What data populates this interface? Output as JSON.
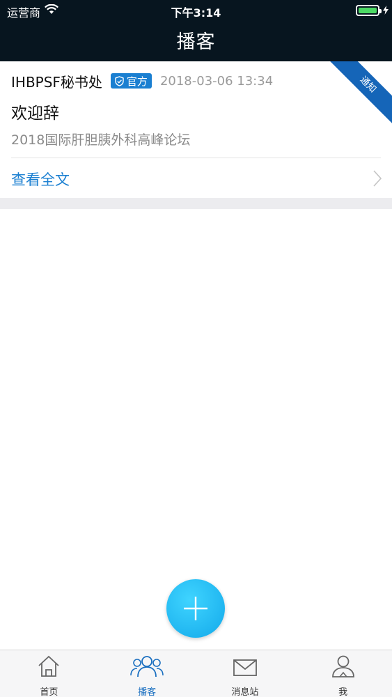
{
  "status_bar": {
    "carrier": "运营商",
    "time": "下午3:14",
    "battery_level": 1.0,
    "charging": true
  },
  "nav": {
    "title": "播客"
  },
  "post": {
    "author": "IHBPSF秘书处",
    "badge": "官方",
    "timestamp": "2018-03-06 13:34",
    "ribbon": "通知",
    "title": "欢迎辞",
    "summary": "2018国际肝胆胰外科高峰论坛",
    "read_more": "查看全文"
  },
  "fab": {
    "icon": "plus-icon"
  },
  "tabbar": {
    "active_index": 1,
    "items": [
      {
        "label": "首页",
        "icon": "home-icon"
      },
      {
        "label": "播客",
        "icon": "users-icon"
      },
      {
        "label": "消息站",
        "icon": "mail-icon"
      },
      {
        "label": "我",
        "icon": "person-icon"
      }
    ]
  },
  "colors": {
    "header_bg": "#07151f",
    "accent": "#1a7fd1",
    "ribbon": "#1565b8",
    "fab": "#13a9ea",
    "battery": "#4cd964"
  }
}
